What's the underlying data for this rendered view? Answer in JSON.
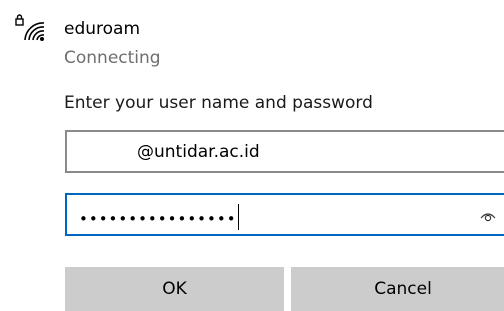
{
  "network": {
    "name": "eduroam",
    "status": "Connecting",
    "icon": "wifi-secured-icon"
  },
  "form": {
    "prompt": "Enter your user name and password",
    "username": {
      "value": "@untidar.ac.id"
    },
    "password": {
      "masked_value": "••••••••••••••••",
      "reveal_icon": "eye-icon"
    }
  },
  "buttons": {
    "ok_label": "OK",
    "cancel_label": "Cancel"
  },
  "colors": {
    "focus_border": "#0067c0",
    "button_bg": "#cccccc",
    "secondary_text": "#6e6e6e"
  }
}
